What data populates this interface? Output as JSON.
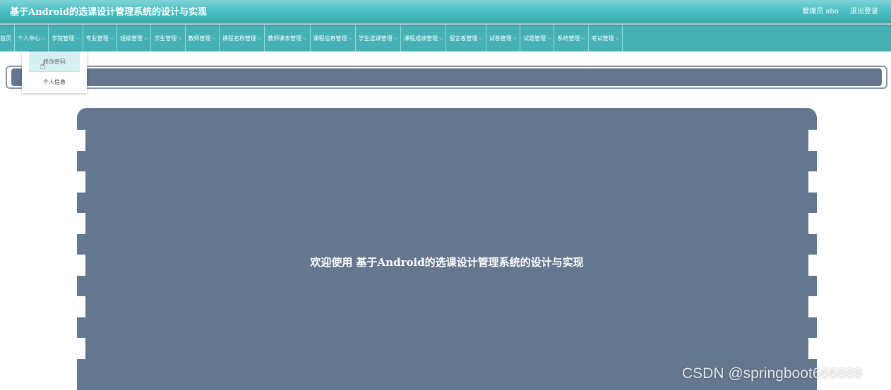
{
  "header": {
    "title": "基于Android的选课设计管理系统的设计与实现",
    "user_label": "管理员 abo",
    "logout_label": "退出登录"
  },
  "nav": {
    "home": "首页",
    "items": [
      {
        "label": "个人中心"
      },
      {
        "label": "学院管理"
      },
      {
        "label": "专业管理"
      },
      {
        "label": "班级管理"
      },
      {
        "label": "学生管理"
      },
      {
        "label": "教师管理"
      },
      {
        "label": "课程名称管理"
      },
      {
        "label": "教师课表管理"
      },
      {
        "label": "课程信息管理"
      },
      {
        "label": "学生选课管理"
      },
      {
        "label": "课程成绩管理"
      },
      {
        "label": "留言板管理"
      },
      {
        "label": "试卷管理"
      },
      {
        "label": "试题管理"
      },
      {
        "label": "系统管理"
      },
      {
        "label": "考试管理"
      }
    ],
    "chevron": "⌵"
  },
  "dropdown": {
    "items": [
      {
        "label": "修改密码"
      },
      {
        "label": "个人信息"
      }
    ]
  },
  "main": {
    "welcome": "欢迎使用 基于Android的选课设计管理系统的设计与实现"
  },
  "watermark": "CSDN @springboot666888",
  "colors": {
    "header_teal": "#4cc0c4",
    "nav_teal": "#45b1b5",
    "panel_slate": "#65778f"
  }
}
